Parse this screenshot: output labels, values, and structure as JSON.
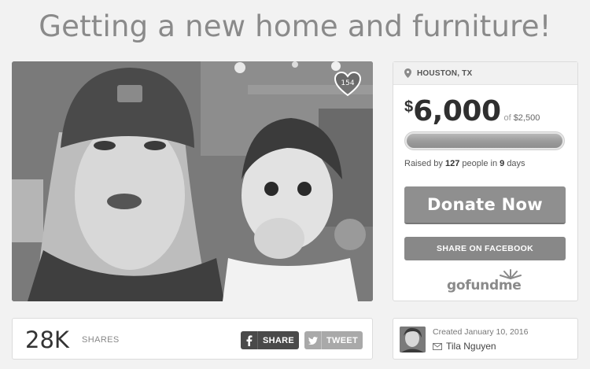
{
  "campaign": {
    "title": "Getting a new home and furniture!",
    "likes": "154"
  },
  "card": {
    "location": "HOUSTON, TX",
    "currency": "$",
    "raised": "6,000",
    "of_label": "of",
    "goal": "$2,500",
    "progress_fraction": 1.0,
    "raised_by_prefix": "Raised by",
    "people_count": "127",
    "people_mid": "people in",
    "days": "9",
    "days_suffix": "days",
    "donate_label": "Donate Now",
    "share_fb_label": "SHARE ON FACEBOOK",
    "brand": "gofundme"
  },
  "sharebar": {
    "count": "28K",
    "label": "SHARES",
    "fb_label": "SHARE",
    "tw_label": "TWEET"
  },
  "organizer": {
    "created": "Created January 10, 2016",
    "name": "Tila Nguyen"
  },
  "colors": {
    "accent": "#8f8f8f",
    "title": "#8a8a8a"
  },
  "icons": [
    "heart-icon",
    "location-pin-icon",
    "facebook-icon",
    "twitter-icon",
    "mail-icon",
    "gofundme-logo"
  ]
}
